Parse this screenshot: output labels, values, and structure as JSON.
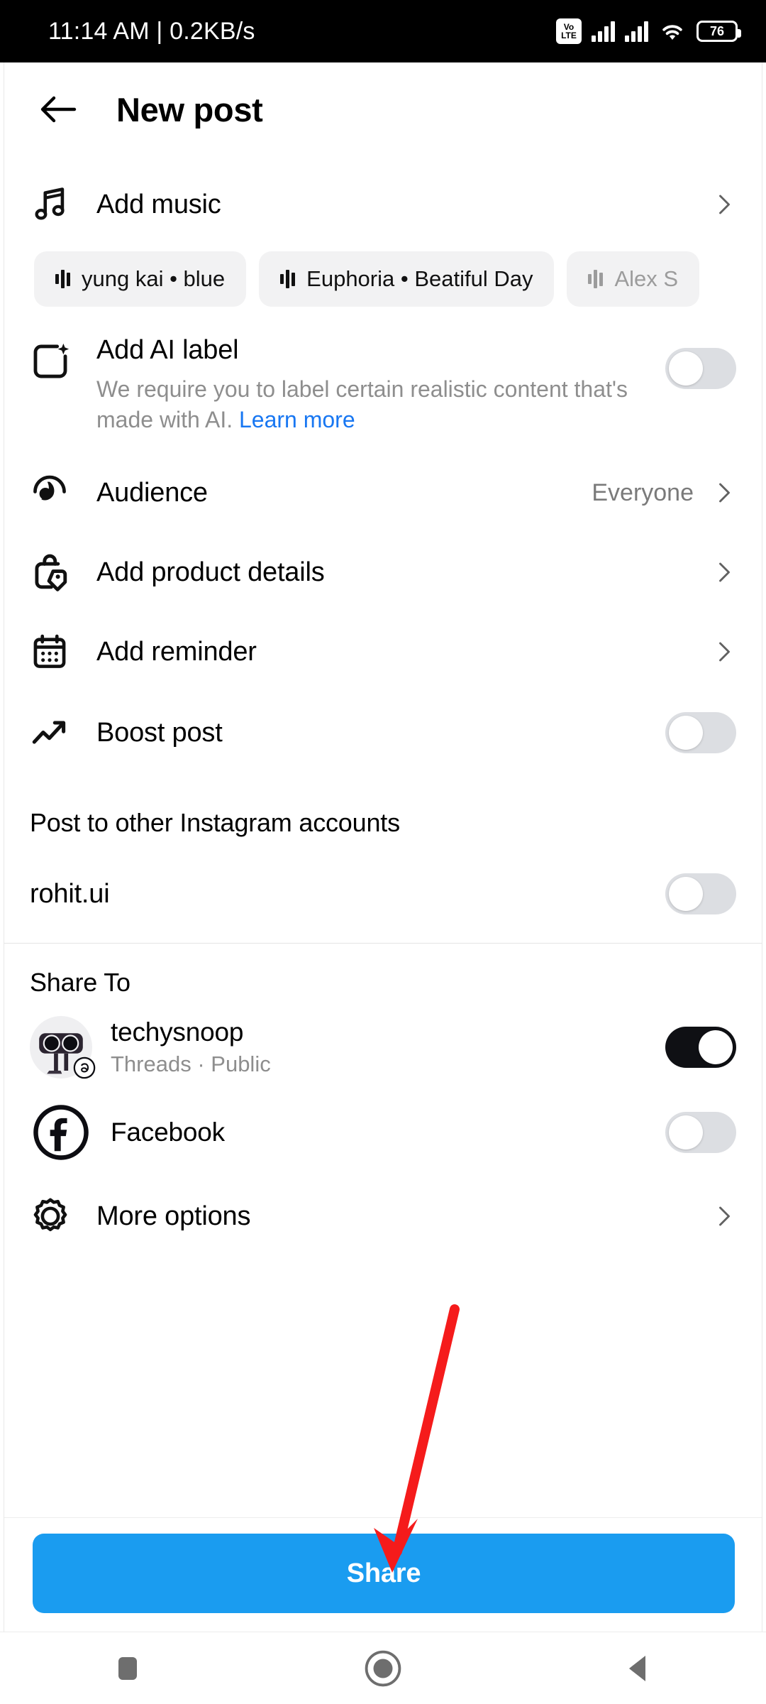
{
  "status_bar": {
    "time": "11:14 AM",
    "separator": "|",
    "network_speed": "0.2KB/s",
    "volte_top": "Vo",
    "volte_bottom": "LTE",
    "battery_percent": "76"
  },
  "header": {
    "back_icon": "back-arrow-icon",
    "title": "New post"
  },
  "music": {
    "label": "Add music",
    "icon": "music-note-icon",
    "chevron": "chevron-right-icon",
    "suggestions": [
      {
        "text": "yung kai • blue",
        "faded": false
      },
      {
        "text": "Euphoria • Beatiful Day",
        "faded": false
      },
      {
        "text": "Alex S",
        "faded": true
      }
    ]
  },
  "ai_label": {
    "icon": "ai-sparkle-frame-icon",
    "title": "Add AI label",
    "description": "We require you to label certain realistic content that's made with AI.",
    "learn_more": "Learn more",
    "toggle_on": false
  },
  "options": [
    {
      "name": "audience",
      "icon": "audience-icon",
      "label": "Audience",
      "value": "Everyone",
      "chevron": "chevron-right-icon"
    },
    {
      "name": "product-details",
      "icon": "shopping-tag-icon",
      "label": "Add product details",
      "value": "",
      "chevron": "chevron-right-icon"
    },
    {
      "name": "reminder",
      "icon": "calendar-icon",
      "label": "Add reminder",
      "value": "",
      "chevron": "chevron-right-icon"
    }
  ],
  "boost": {
    "icon": "trending-up-icon",
    "label": "Boost post",
    "toggle_on": false
  },
  "other_accounts": {
    "title": "Post to other Instagram accounts",
    "accounts": [
      {
        "name": "rohit.ui",
        "toggle_on": false
      }
    ]
  },
  "share_to": {
    "title": "Share To",
    "items": [
      {
        "name": "techysnoop",
        "subtitle": "Threads · Public",
        "avatar": "threads-avatar",
        "badge": "threads-badge-icon",
        "toggle_on": true
      },
      {
        "name": "Facebook",
        "subtitle": "",
        "avatar": "facebook-icon",
        "badge": "",
        "toggle_on": false
      }
    ],
    "more_options": {
      "icon": "gear-icon",
      "label": "More options",
      "chevron": "chevron-right-icon"
    }
  },
  "footer": {
    "share_label": "Share"
  },
  "nav_bar": {
    "recents_icon": "square-recents-icon",
    "home_icon": "circle-home-icon",
    "back_icon": "triangle-back-icon"
  },
  "annotation": {
    "arrow_color": "#f51b1b",
    "target": "share-button"
  },
  "colors": {
    "accent_blue": "#1a9cf0",
    "link_blue": "#1877f2",
    "toggle_on": "#0f1014",
    "toggle_off": "#dcdee2",
    "muted_text": "#8e8e8e"
  }
}
